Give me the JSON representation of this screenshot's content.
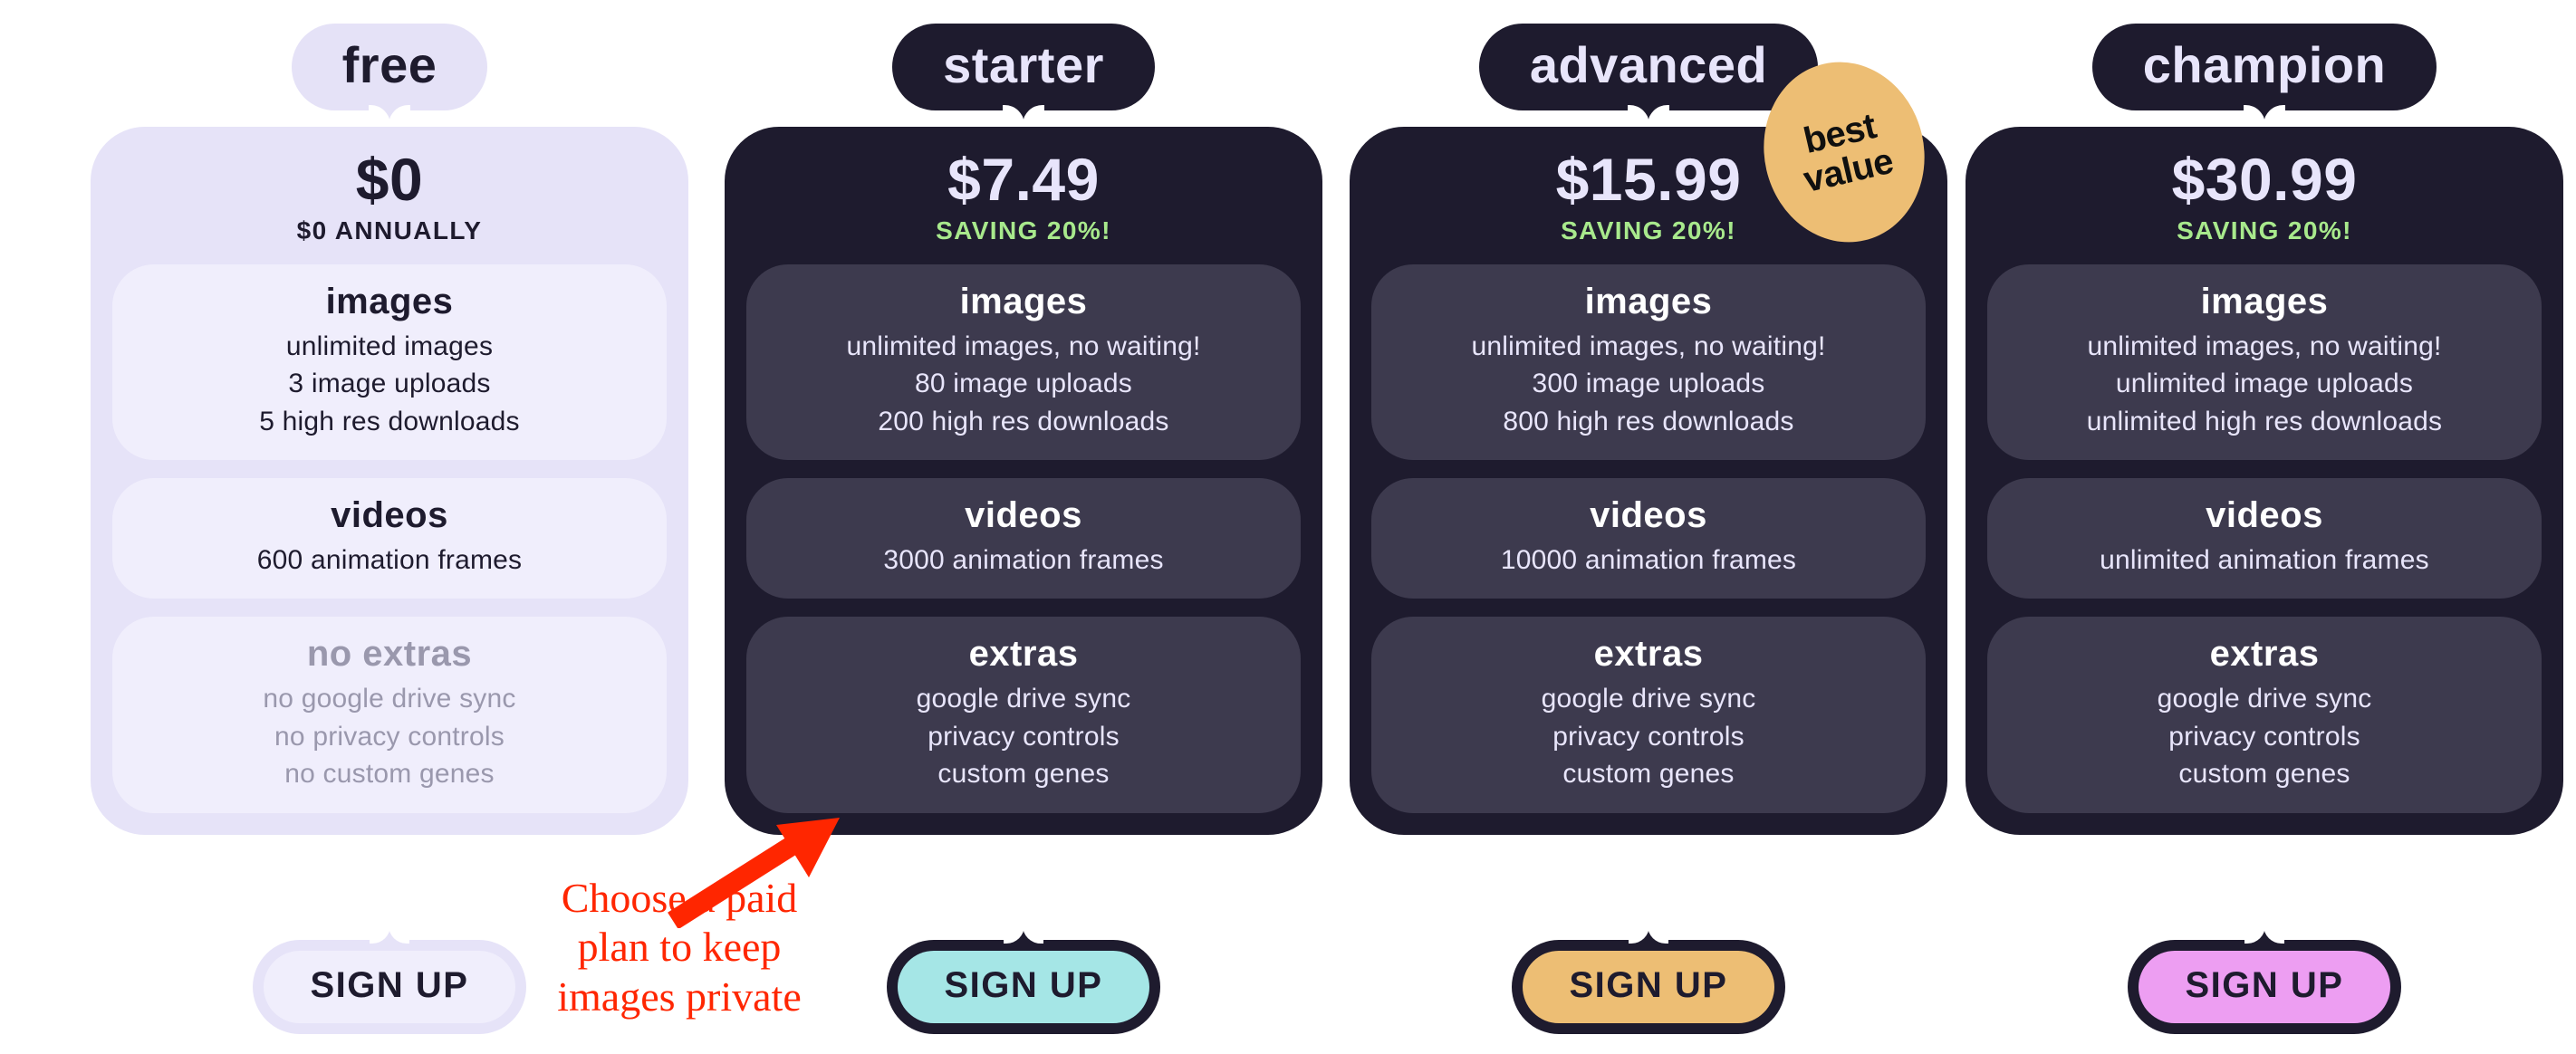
{
  "page": {
    "background": "#ffffff",
    "accent_green": "#a8e98c",
    "annotation_color": "#ff2600"
  },
  "annotation": {
    "text": "Choose a paid plan to keep images private",
    "line1": "Choose a paid",
    "line2": "plan to keep",
    "line3": "images private",
    "arrow_color": "#ff2600"
  },
  "badge": {
    "line1": "best",
    "line2": "value",
    "bg": "#edbe74"
  },
  "plans": [
    {
      "id": "free",
      "name": "free",
      "price": "$0",
      "subprice": "$0 ANNUALLY",
      "saving": "",
      "tab_bg": "#e5e2f7",
      "tab_fg": "#1e1b2e",
      "card_bg": "#e6e3f8",
      "card_fg": "#1e1b2e",
      "section_bg": "#f0eefc",
      "price_color": "#1e1b2e",
      "subprice_color": "#1e1b2e",
      "button_outer": "#e6e3f8",
      "button_inner": "#f0eefc",
      "button_fg": "#1e1b2e",
      "button_label": "SIGN UP",
      "sections": [
        {
          "title": "images",
          "title_color": "#1e1b2e",
          "text_color": "#1e1b2e",
          "lines": [
            "unlimited images",
            "3 image uploads",
            "5 high res downloads"
          ]
        },
        {
          "title": "videos",
          "title_color": "#1e1b2e",
          "text_color": "#1e1b2e",
          "lines": [
            "600 animation frames"
          ]
        },
        {
          "title": "no extras",
          "title_color": "#9a98ad",
          "text_color": "#9a98ad",
          "lines": [
            "no google drive sync",
            "no privacy controls",
            "no custom genes"
          ]
        }
      ]
    },
    {
      "id": "starter",
      "name": "starter",
      "price": "$7.49",
      "subprice": "SAVING 20%!",
      "tab_bg": "#1e1b2e",
      "tab_fg": "#e8e5fb",
      "card_bg": "#1e1b2e",
      "card_fg": "#e8e5fb",
      "section_bg": "#3d3a4e",
      "price_color": "#e8e5fb",
      "subprice_color": "#a8e98c",
      "button_outer": "#1e1b2e",
      "button_inner": "#a5e6e6",
      "button_fg": "#1e1b2e",
      "button_label": "SIGN UP",
      "sections": [
        {
          "title": "images",
          "title_color": "#ffffff",
          "text_color": "#e8e5fb",
          "lines": [
            "unlimited images, no waiting!",
            "80 image uploads",
            "200 high res downloads"
          ]
        },
        {
          "title": "videos",
          "title_color": "#ffffff",
          "text_color": "#e8e5fb",
          "lines": [
            "3000 animation frames"
          ]
        },
        {
          "title": "extras",
          "title_color": "#ffffff",
          "text_color": "#e8e5fb",
          "lines": [
            "google drive sync",
            "privacy controls",
            "custom genes"
          ]
        }
      ]
    },
    {
      "id": "advanced",
      "name": "advanced",
      "price": "$15.99",
      "subprice": "SAVING 20%!",
      "tab_bg": "#1e1b2e",
      "tab_fg": "#e8e5fb",
      "card_bg": "#1e1b2e",
      "card_fg": "#e8e5fb",
      "section_bg": "#3d3a4e",
      "price_color": "#e8e5fb",
      "subprice_color": "#a8e98c",
      "button_outer": "#1e1b2e",
      "button_inner": "#edbe74",
      "button_fg": "#1e1b2e",
      "button_label": "SIGN UP",
      "sections": [
        {
          "title": "images",
          "title_color": "#ffffff",
          "text_color": "#e8e5fb",
          "lines": [
            "unlimited images, no waiting!",
            "300 image uploads",
            "800 high res downloads"
          ]
        },
        {
          "title": "videos",
          "title_color": "#ffffff",
          "text_color": "#e8e5fb",
          "lines": [
            "10000 animation frames"
          ]
        },
        {
          "title": "extras",
          "title_color": "#ffffff",
          "text_color": "#e8e5fb",
          "lines": [
            "google drive sync",
            "privacy controls",
            "custom genes"
          ]
        }
      ]
    },
    {
      "id": "champion",
      "name": "champion",
      "price": "$30.99",
      "subprice": "SAVING 20%!",
      "tab_bg": "#1e1b2e",
      "tab_fg": "#e8e5fb",
      "card_bg": "#1e1b2e",
      "card_fg": "#e8e5fb",
      "section_bg": "#3d3a4e",
      "price_color": "#e8e5fb",
      "subprice_color": "#a8e98c",
      "button_outer": "#1e1b2e",
      "button_inner": "#ed9ef2",
      "button_fg": "#1e1b2e",
      "button_label": "SIGN UP",
      "sections": [
        {
          "title": "images",
          "title_color": "#ffffff",
          "text_color": "#e8e5fb",
          "lines": [
            "unlimited images, no waiting!",
            "unlimited image uploads",
            "unlimited high res downloads"
          ]
        },
        {
          "title": "videos",
          "title_color": "#ffffff",
          "text_color": "#e8e5fb",
          "lines": [
            "unlimited animation frames"
          ]
        },
        {
          "title": "extras",
          "title_color": "#ffffff",
          "text_color": "#e8e5fb",
          "lines": [
            "google drive sync",
            "privacy controls",
            "custom genes"
          ]
        }
      ]
    }
  ]
}
